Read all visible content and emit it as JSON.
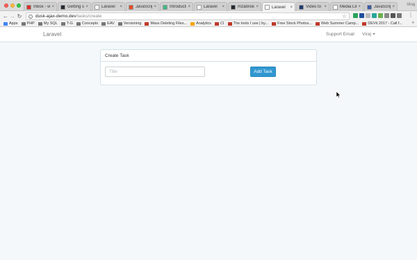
{
  "browser": {
    "tabs": [
      {
        "label": "Inbox - vira",
        "favicon_color": "#d93025",
        "active": false
      },
      {
        "label": "Getting sta",
        "favicon_color": "#24292e",
        "active": false
      },
      {
        "label": "Laravel",
        "favicon_color": "#ffffff",
        "active": false
      },
      {
        "label": "JavaScript",
        "favicon_color": "#e44d26",
        "active": false
      },
      {
        "label": "Introductio",
        "favicon_color": "#41b883",
        "active": false
      },
      {
        "label": "Laravel",
        "favicon_color": "#ffffff",
        "active": false
      },
      {
        "label": "mzabriskie",
        "favicon_color": "#24292e",
        "active": false
      },
      {
        "label": "Laravel",
        "favicon_color": "#ffffff",
        "active": true
      },
      {
        "label": "Video to an",
        "favicon_color": "#1e3a6e",
        "active": false
      },
      {
        "label": "Media Libr",
        "favicon_color": "#ffffff",
        "active": false
      },
      {
        "label": "JavaScript",
        "favicon_color": "#3b5ba5",
        "active": false
      }
    ],
    "profile_label": "Viraj",
    "url_host": "dusk-ajax-demo.dev",
    "url_path": "/tasks/create",
    "extension_colors": [
      "#2aa35b",
      "#1f4e9b",
      "#bbbbbb",
      "#26a69a",
      "#6ab04c",
      "#888888",
      "#555555",
      "#777777"
    ]
  },
  "bookmarks": [
    {
      "label": "Apps",
      "icon": "apps-icon"
    },
    {
      "label": "PHP",
      "icon": "folder-icon"
    },
    {
      "label": "My SQL",
      "icon": "folder-icon"
    },
    {
      "label": "T-G",
      "icon": "folder-icon"
    },
    {
      "label": "Concepts",
      "icon": "folder-icon"
    },
    {
      "label": "EAV",
      "icon": "folder-icon"
    },
    {
      "label": "Versioning",
      "icon": "folder-icon"
    },
    {
      "label": "Mass Deleting Files...",
      "icon": "page-icon"
    },
    {
      "label": "Analytics",
      "icon": "analytics-icon"
    },
    {
      "label": "CI",
      "icon": "page-icon"
    },
    {
      "label": "The tools I use | by...",
      "icon": "page-icon"
    },
    {
      "label": "Free Stock Photos...",
      "icon": "page-icon"
    },
    {
      "label": "Web Summer Camp...",
      "icon": "page-icon"
    },
    {
      "label": "DEVit 2017 - Call f...",
      "icon": "page-icon"
    }
  ],
  "app": {
    "brand": "Laravel",
    "support_link": "Support Email",
    "user_menu": "Viraj"
  },
  "panel": {
    "heading": "Create Task",
    "title_placeholder": "Title",
    "add_button": "Add Task"
  }
}
